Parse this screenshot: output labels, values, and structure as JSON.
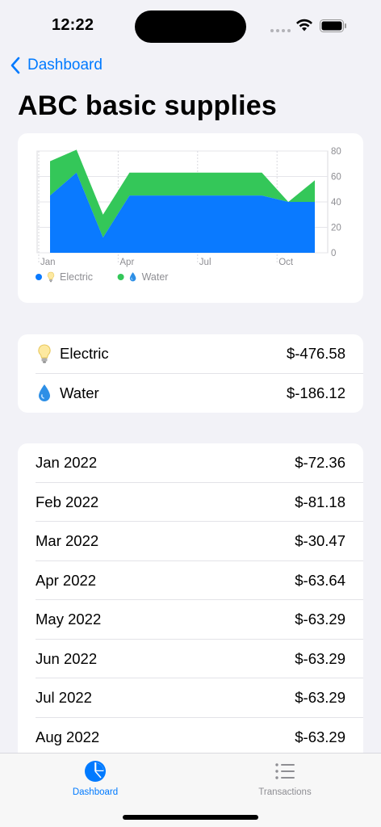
{
  "status_bar": {
    "time": "12:22"
  },
  "nav": {
    "back_label": "Dashboard",
    "title": "ABC basic supplies"
  },
  "colors": {
    "electric": "#0a7aff",
    "water": "#34c759",
    "accent": "#007aff"
  },
  "chart_data": {
    "type": "area",
    "stacked": true,
    "x": [
      "Jan",
      "Feb",
      "Mar",
      "Apr",
      "May",
      "Jun",
      "Jul",
      "Aug",
      "Sep",
      "Oct",
      "Nov"
    ],
    "x_tick_labels": [
      "Jan",
      "Apr",
      "Jul",
      "Oct"
    ],
    "series": [
      {
        "name": "Electric",
        "icon": "lightbulb-icon",
        "color": "#0a7aff",
        "values": [
          45,
          63,
          12,
          45,
          45,
          45,
          45,
          45,
          45,
          40,
          40
        ]
      },
      {
        "name": "Water",
        "icon": "droplet-icon",
        "color": "#34c759",
        "values": [
          27,
          18,
          18,
          18,
          18,
          18,
          18,
          18,
          18,
          0,
          17
        ]
      }
    ],
    "ylim": [
      0,
      80
    ],
    "y_ticks": [
      0,
      20,
      40,
      60,
      80
    ],
    "grid": true,
    "legend": "bottom-left"
  },
  "summary": [
    {
      "label": "Electric",
      "icon": "lightbulb-icon",
      "amount": "$-476.58"
    },
    {
      "label": "Water",
      "icon": "droplet-icon",
      "amount": "$-186.12"
    }
  ],
  "monthly": [
    {
      "month": "Jan 2022",
      "amount": "$-72.36"
    },
    {
      "month": "Feb 2022",
      "amount": "$-81.18"
    },
    {
      "month": "Mar 2022",
      "amount": "$-30.47"
    },
    {
      "month": "Apr 2022",
      "amount": "$-63.64"
    },
    {
      "month": "May 2022",
      "amount": "$-63.29"
    },
    {
      "month": "Jun 2022",
      "amount": "$-63.29"
    },
    {
      "month": "Jul 2022",
      "amount": "$-63.29"
    },
    {
      "month": "Aug 2022",
      "amount": "$-63.29"
    }
  ],
  "tabs": [
    {
      "label": "Dashboard",
      "icon": "pie-chart-icon",
      "selected": true
    },
    {
      "label": "Transactions",
      "icon": "list-icon",
      "selected": false
    }
  ]
}
